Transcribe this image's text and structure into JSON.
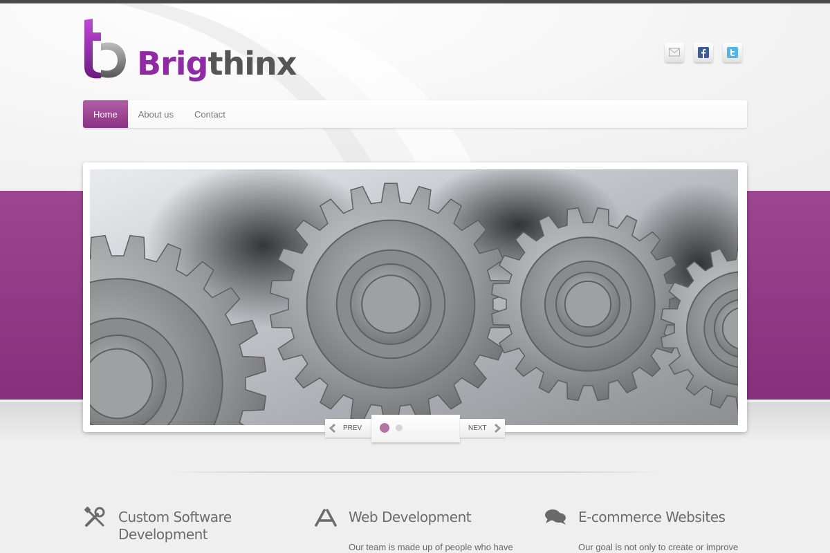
{
  "brand": {
    "name_part1": "Brig",
    "name_part2": "thinx",
    "accent_color": "#8e2aa3"
  },
  "social": [
    {
      "icon": "mail-icon",
      "label": "Email"
    },
    {
      "icon": "facebook-icon",
      "label": "Facebook"
    },
    {
      "icon": "twitter-icon",
      "label": "Twitter"
    }
  ],
  "nav": {
    "items": [
      {
        "label": "Home",
        "active": true
      },
      {
        "label": "About us",
        "active": false
      },
      {
        "label": "Contact",
        "active": false
      }
    ]
  },
  "slider": {
    "image": "gears-image",
    "prev_label": "PREV",
    "next_label": "NEXT",
    "current_slide": 1,
    "slide_count": 2
  },
  "features": [
    {
      "icon": "wrench-screwdriver-icon",
      "title_line1": "Custom Software",
      "title_line2": "Development",
      "text": ""
    },
    {
      "icon": "app-store-icon",
      "title_line1": "Web Development",
      "title_line2": "",
      "text": "Our team is made up of people who have"
    },
    {
      "icon": "chat-bubbles-icon",
      "title_line1": "E-commerce Websites",
      "title_line2": "",
      "text": "Our goal is not only to create or improve"
    }
  ]
}
